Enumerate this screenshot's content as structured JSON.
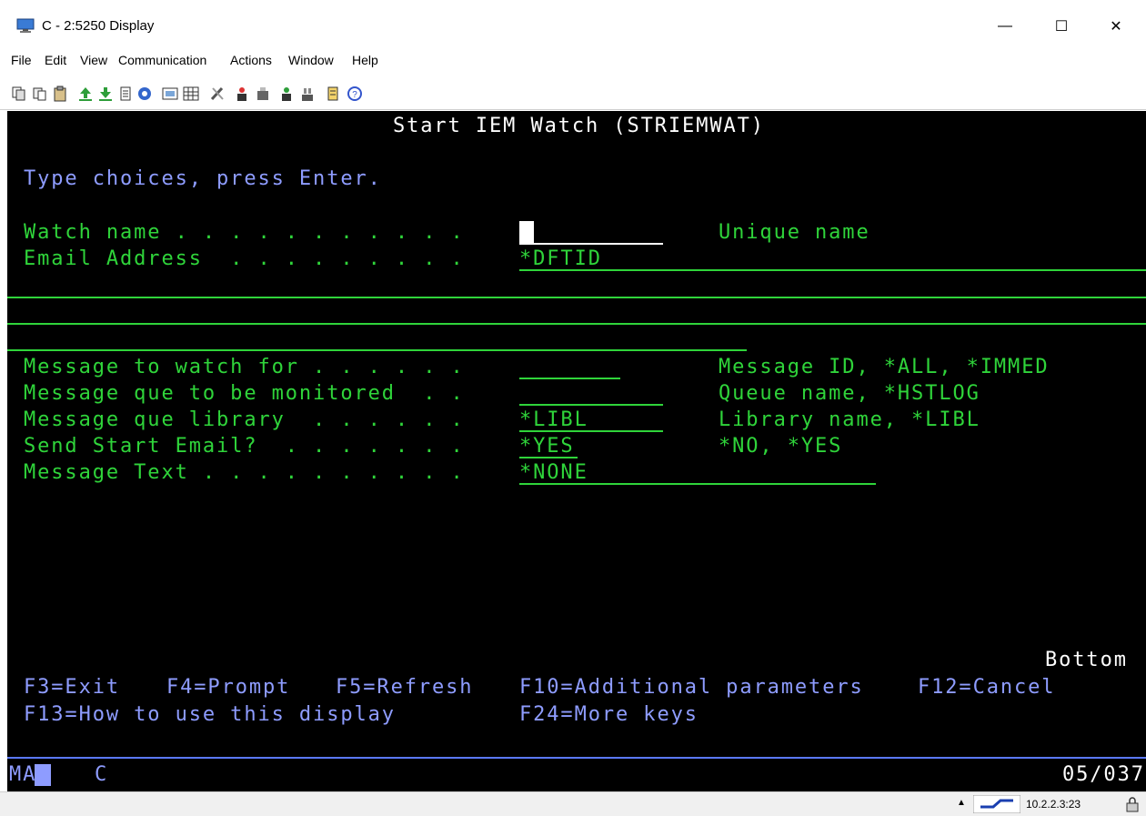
{
  "window": {
    "title": "C - 2:5250 Display",
    "controls": {
      "minimize": "—",
      "maximize": "☐",
      "close": "✕"
    }
  },
  "menu": [
    "File",
    "Edit",
    "View",
    "Communication",
    "Actions",
    "Window",
    "Help"
  ],
  "toolbar_icons": [
    "copy-icon",
    "paste-icon",
    "clipboard-icon",
    "upload-icon",
    "download-icon",
    "macro-icon",
    "settings-icon",
    "keypad-icon",
    "grid-icon",
    "tools-icon",
    "user-record-icon",
    "print-icon",
    "user-play-icon",
    "stop-icon",
    "note-icon",
    "help-icon"
  ],
  "screen": {
    "title": "Start IEM Watch (STRIEMWAT)",
    "instruction": "Type choices, press Enter.",
    "fields": {
      "watch_name": {
        "label": "Watch name . . . . . . . . . . .",
        "value": "",
        "hint": "Unique name"
      },
      "email_address": {
        "label": "Email Address  . . . . . . . . .",
        "value": "*DFTID"
      },
      "message_to_watch": {
        "label": "Message to watch for . . . . . .",
        "value": "",
        "hint": "Message ID, *ALL, *IMMED"
      },
      "message_queue": {
        "label": "Message que to be monitored  . .",
        "value": "",
        "hint": "Queue name, *HSTLOG"
      },
      "message_queue_library": {
        "label": "Message que library  . . . . . .",
        "value": "*LIBL",
        "hint": "Library name, *LIBL"
      },
      "send_start_email": {
        "label": "Send Start Email?  . . . . . . .",
        "value": "*YES",
        "hint": "*NO, *YES"
      },
      "message_text": {
        "label": "Message Text . . . . . . . . . .",
        "value": "*NONE"
      }
    },
    "bottom": "Bottom",
    "fkeys_row1": [
      "F3=Exit",
      "F4=Prompt",
      "F5=Refresh",
      "F10=Additional parameters",
      "F12=Cancel"
    ],
    "fkeys_row2": [
      "F13=How to use this display",
      "F24=More keys"
    ]
  },
  "oia": {
    "indicator": "MA",
    "session": "C",
    "cursor_position": "05/037"
  },
  "status": {
    "address": "10.2.2.3:23"
  },
  "colors": {
    "green": "#2fd43a",
    "white": "#ffffff",
    "blue": "#8e9cff",
    "screen_bg": "#000000"
  }
}
